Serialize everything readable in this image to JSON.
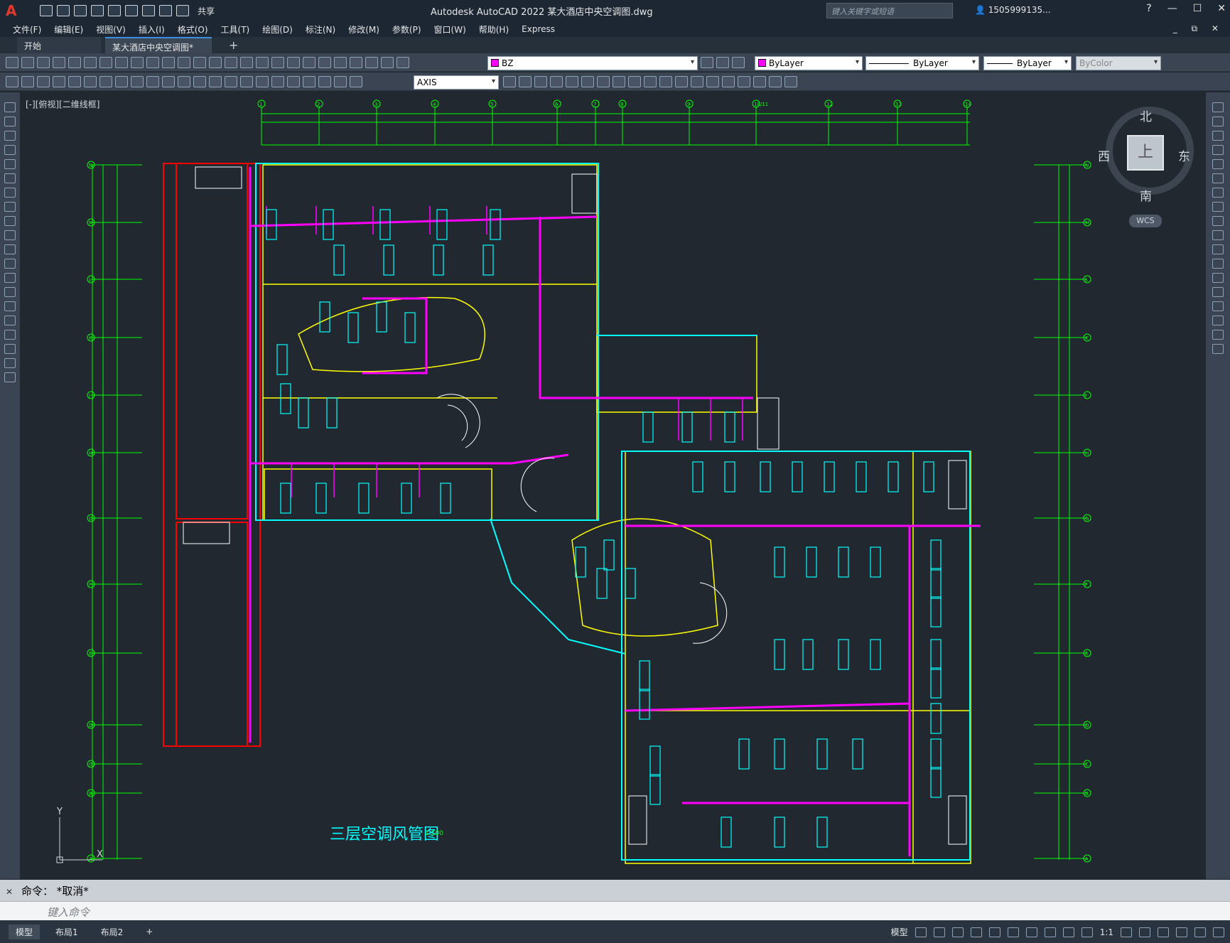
{
  "app": {
    "title": "Autodesk AutoCAD 2022    某大酒店中央空调图.dwg",
    "share_label": "共享",
    "search_placeholder": "键入关键字或短语",
    "user": "1505999135...",
    "help": "?"
  },
  "menu": [
    "文件(F)",
    "编辑(E)",
    "视图(V)",
    "插入(I)",
    "格式(O)",
    "工具(T)",
    "绘图(D)",
    "标注(N)",
    "修改(M)",
    "参数(P)",
    "窗口(W)",
    "帮助(H)",
    "Express"
  ],
  "tabs": {
    "start": "开始",
    "document": "某大酒店中央空调图*",
    "add": "+"
  },
  "properties": {
    "layer": "BZ",
    "layer_color": "#ff00ff",
    "color": "ByLayer",
    "linetype": "ByLayer",
    "lineweight": "ByLayer",
    "plotstyle": "ByColor",
    "dimstyle": "AXIS"
  },
  "viewport_label": "[-][俯视][二维线框]",
  "viewcube": {
    "north": "北",
    "south": "南",
    "east": "东",
    "west": "西",
    "face": "上",
    "wcs": "WCS"
  },
  "drawing": {
    "title": "三层空调风管图",
    "scale_note": "1:100",
    "grid_columns": [
      "1",
      "2",
      "3",
      "4",
      "5",
      "6",
      "7",
      "8",
      "9",
      "10/11",
      "12",
      "13",
      "14"
    ],
    "grid_rows": [
      "N",
      "M",
      "L",
      "K",
      "J",
      "H",
      "G",
      "F",
      "E",
      "D",
      "C",
      "B",
      "A"
    ],
    "colors": {
      "wall_yellow": "#ffff00",
      "duct_magenta": "#ff00ff",
      "cyan": "#00ffff",
      "green": "#00ff00",
      "red": "#ff0000"
    }
  },
  "command": {
    "history": "命令：  *取消*",
    "input_placeholder": "键入命令"
  },
  "status": {
    "layout_tabs": [
      "模型",
      "布局1",
      "布局2"
    ],
    "model_label": "模型",
    "scale": "1:1"
  }
}
